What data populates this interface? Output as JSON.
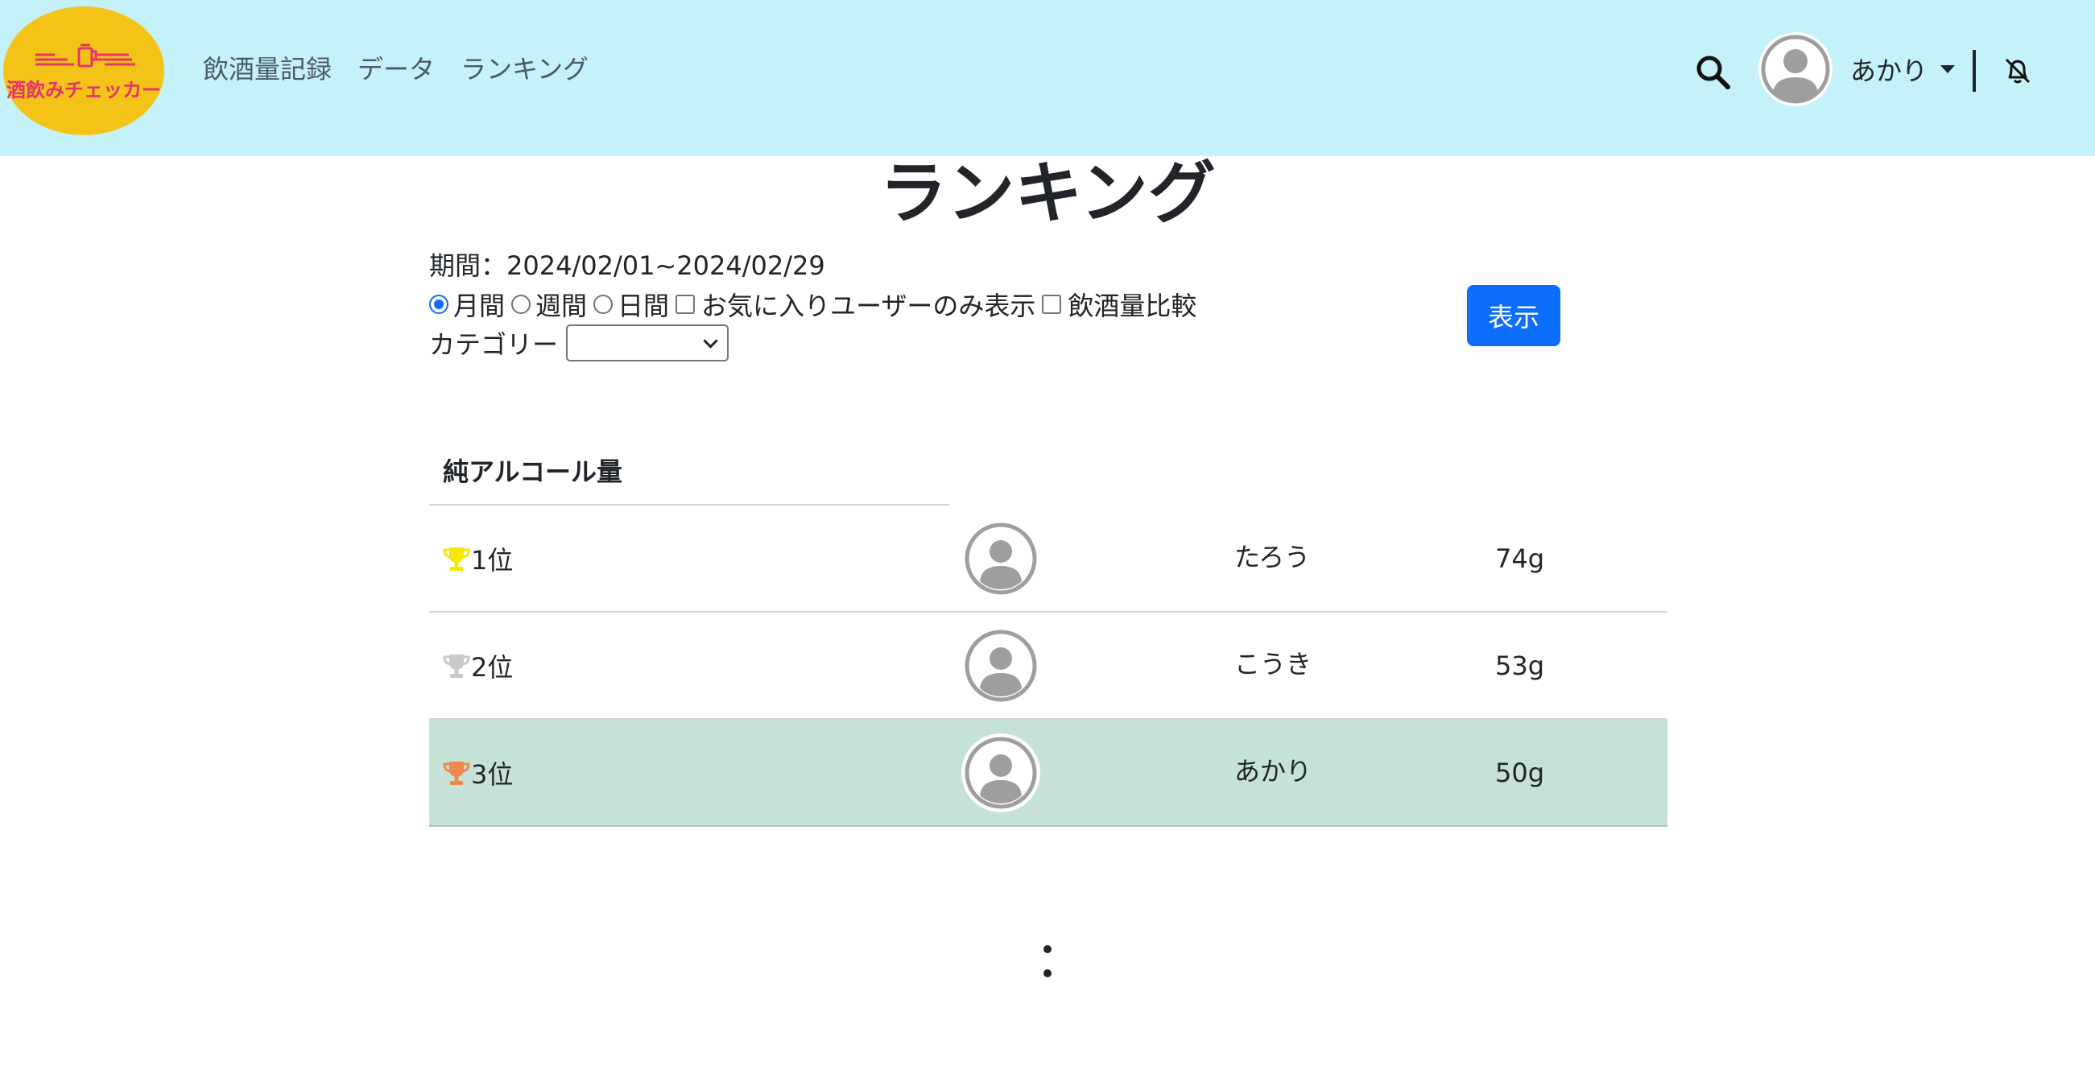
{
  "header": {
    "logo_text": "酒飲みチェッカー",
    "nav": [
      "飲酒量記録",
      "データ",
      "ランキング"
    ],
    "user_name": "あかり",
    "icons": {
      "search": "search-icon",
      "avatar": "user-avatar-icon",
      "menu": "caret-down-icon",
      "notifications": "bell-slash-icon"
    }
  },
  "page": {
    "title": "ランキング",
    "period": "期間：2024/02/01~2024/02/29",
    "filters": {
      "monthly": "月間",
      "weekly": "週間",
      "daily": "日間",
      "favorites_only": "お気に入りユーザーのみ表示",
      "compare": "飲酒量比較",
      "selected": "月間"
    },
    "category_label": "カテゴリー",
    "category_value": "",
    "show_button": "表示"
  },
  "ranking": {
    "header": "純アルコール量",
    "rows": [
      {
        "rank": "1位",
        "name": "たろう",
        "amount": "74g",
        "trophy": "gold-trophy-icon",
        "trophy_color": "#f5e80a"
      },
      {
        "rank": "2位",
        "name": "こうき",
        "amount": "53g",
        "trophy": "silver-trophy-icon",
        "trophy_color": "#c9c9c9"
      },
      {
        "rank": "3位",
        "name": "あかり",
        "amount": "50g",
        "trophy": "bronze-trophy-icon",
        "trophy_color": "#ef8a4d"
      }
    ],
    "highlight_row_color": "#c6e2d7",
    "more_icon": "vertical-ellipsis-icon"
  },
  "colors": {
    "navbar": "#c5f1f9",
    "logo_bg": "#f3c318",
    "logo_text": "#e8336b",
    "primary": "#0d6efd"
  }
}
